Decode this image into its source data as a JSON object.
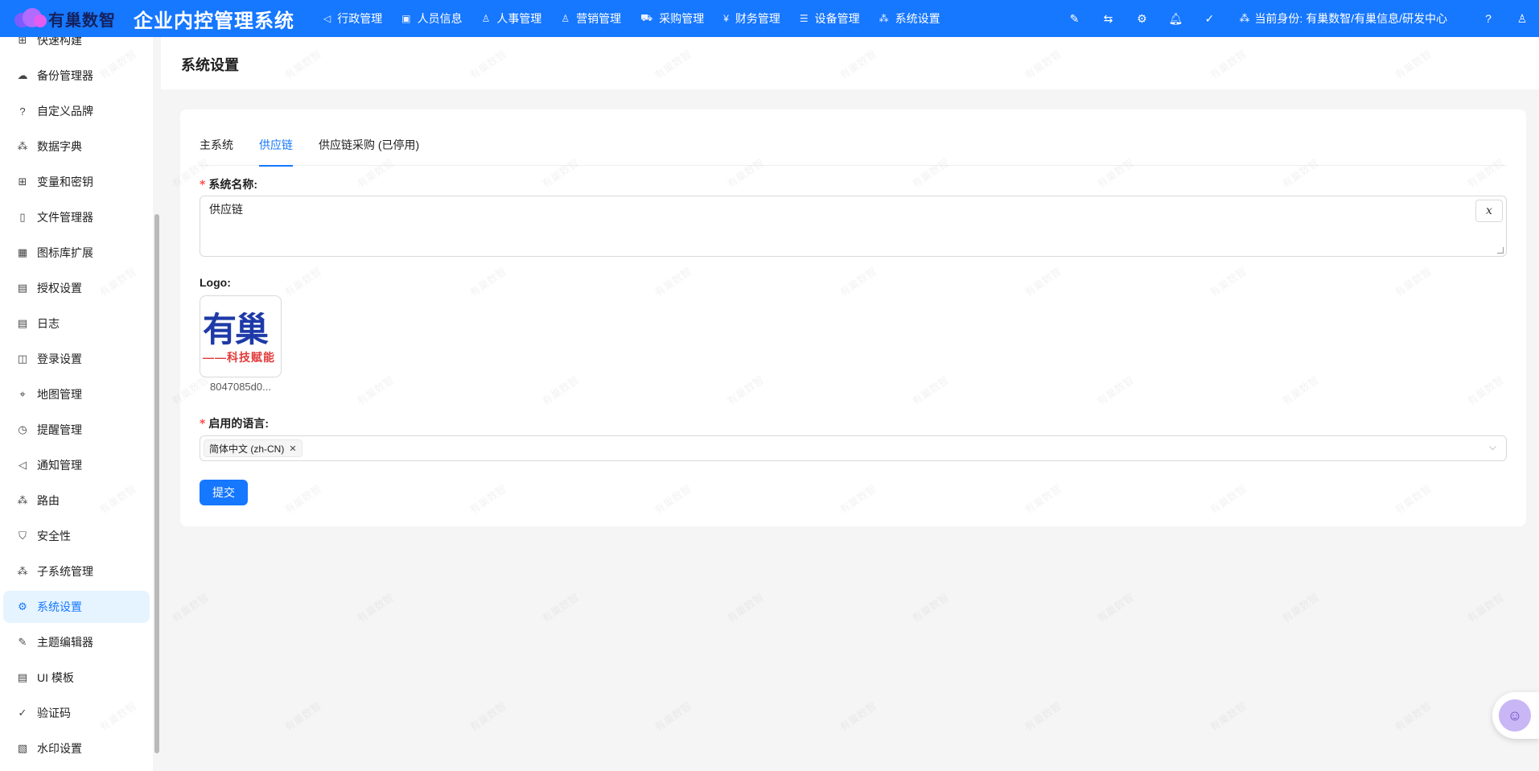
{
  "brand": {
    "logo_text": "有巢数智",
    "app_title": "企业内控管理系统"
  },
  "top_nav": [
    {
      "label": "行政管理",
      "icon": "send-icon",
      "glyph": "◁"
    },
    {
      "label": "人员信息",
      "icon": "id-card-icon",
      "glyph": "▣"
    },
    {
      "label": "人事管理",
      "icon": "user-icon",
      "glyph": "♙"
    },
    {
      "label": "营销管理",
      "icon": "user-icon",
      "glyph": "♙"
    },
    {
      "label": "采购管理",
      "icon": "cart-icon",
      "glyph": "⛟"
    },
    {
      "label": "财务管理",
      "icon": "yuan-icon",
      "glyph": "¥"
    },
    {
      "label": "设备管理",
      "icon": "list-icon",
      "glyph": "☰"
    },
    {
      "label": "系统设置",
      "icon": "cluster-icon",
      "glyph": "⁂"
    }
  ],
  "header_right": {
    "icons": [
      "highlight-icon",
      "swap-icon",
      "gear-icon",
      "bell-icon",
      "check-circle-icon"
    ],
    "identity_label": "当前身份: 有巢数智/有巢信息/研发中心",
    "help_icon": "question-icon",
    "user_icon": "user-icon"
  },
  "sidebar": {
    "items": [
      {
        "label": "快速构建",
        "icon": "build-icon",
        "glyph": "⊞"
      },
      {
        "label": "备份管理器",
        "icon": "cloud-icon",
        "glyph": "☁"
      },
      {
        "label": "自定义品牌",
        "icon": "question-icon",
        "glyph": "?"
      },
      {
        "label": "数据字典",
        "icon": "cluster-icon",
        "glyph": "⁂"
      },
      {
        "label": "变量和密钥",
        "icon": "table-icon",
        "glyph": "⊞"
      },
      {
        "label": "文件管理器",
        "icon": "file-icon",
        "glyph": "▯"
      },
      {
        "label": "图标库扩展",
        "icon": "appstore-icon",
        "glyph": "▦"
      },
      {
        "label": "授权设置",
        "icon": "file-protect-icon",
        "glyph": "▤"
      },
      {
        "label": "日志",
        "icon": "file-text-icon",
        "glyph": "▤"
      },
      {
        "label": "登录设置",
        "icon": "login-icon",
        "glyph": "◫"
      },
      {
        "label": "地图管理",
        "icon": "location-icon",
        "glyph": "⌖"
      },
      {
        "label": "提醒管理",
        "icon": "clock-icon",
        "glyph": "◷"
      },
      {
        "label": "通知管理",
        "icon": "notification-icon",
        "glyph": "◁"
      },
      {
        "label": "路由",
        "icon": "route-icon",
        "glyph": "⁂"
      },
      {
        "label": "安全性",
        "icon": "shield-icon",
        "glyph": "⛉"
      },
      {
        "label": "子系统管理",
        "icon": "cluster-icon",
        "glyph": "⁂"
      },
      {
        "label": "系统设置",
        "icon": "gear-icon",
        "glyph": "⚙",
        "active": true
      },
      {
        "label": "主题编辑器",
        "icon": "brush-icon",
        "glyph": "✎"
      },
      {
        "label": "UI 模板",
        "icon": "layout-icon",
        "glyph": "▤"
      },
      {
        "label": "验证码",
        "icon": "check-circle-icon",
        "glyph": "✓"
      },
      {
        "label": "水印设置",
        "icon": "watermark-icon",
        "glyph": "▧"
      }
    ]
  },
  "page": {
    "title": "系统设置",
    "tabs": [
      {
        "label": "主系统",
        "active": false
      },
      {
        "label": "供应链",
        "active": true
      },
      {
        "label": "供应链采购 (已停用)",
        "active": false
      }
    ],
    "system_name": {
      "label": "系统名称:",
      "value": "供应链",
      "clear_label": "x"
    },
    "logo": {
      "label": "Logo:",
      "image_text": "有巢",
      "image_subtext": "——科技赋能",
      "filename": "8047085d0..."
    },
    "language": {
      "label": "启用的语言:",
      "tags": [
        "简体中文 (zh-CN)"
      ]
    },
    "submit_label": "提交"
  },
  "watermark_text": "有巢数智",
  "colors": {
    "primary": "#1677ff",
    "required": "#ff4d4f",
    "active_bg": "#e6f4ff"
  }
}
